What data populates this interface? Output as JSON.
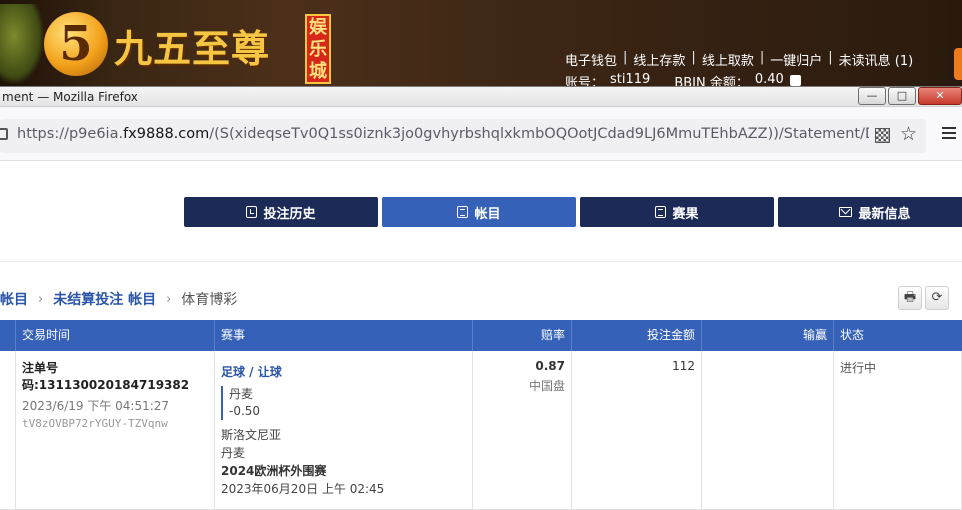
{
  "site": {
    "logo_mark": "5",
    "logo_title": "九五至尊",
    "logo_badge": [
      "娱",
      "乐",
      "城"
    ],
    "top_links": [
      "电子钱包",
      "线上存款",
      "线上取款",
      "一键归户",
      "未读讯息 (1)"
    ],
    "account_label": "账号：",
    "account_value": "sti119",
    "balance_label": "BBIN 余额：",
    "balance_value": "0.40"
  },
  "window": {
    "title": "ment — Mozilla Firefox",
    "buttons": [
      "—",
      "□",
      "✕"
    ]
  },
  "browser": {
    "url_prefix": "https://p9e6ia.",
    "url_host": "fx9888.com",
    "url_rest": "/(S(xideqseTv0Q1ss0iznk3jo0gvhyrbshqlxkmbOQOotJCdad9LJ6MmuTEhbAZZ))/Statement/DBetList?da"
  },
  "nav": {
    "tabs": [
      {
        "label": "投注历史",
        "icon": "clock"
      },
      {
        "label": "帐目",
        "icon": "list"
      },
      {
        "label": "赛果",
        "icon": "list"
      },
      {
        "label": "最新信息",
        "icon": "mail"
      }
    ]
  },
  "breadcrumb": {
    "items": [
      "帐目",
      "未结算投注 帐目"
    ],
    "current": "体育博彩"
  },
  "tools": {
    "print": "🖶",
    "refresh": "⟳"
  },
  "table": {
    "headers": [
      "",
      "交易时间",
      "赛事",
      "赔率",
      "投注金额",
      "输赢",
      "状态"
    ],
    "rows": [
      {
        "bet_no": "注单号码:131130020184719382",
        "time": "2023/6/19 下午 04:51:27",
        "code": "tV8zOVBP72rYGUY-TZVqnw",
        "sport": "足球 / 让球",
        "selection": "丹麦",
        "handicap": "-0.50",
        "home": "斯洛文尼亚",
        "away": "丹麦",
        "league": "2024欧洲杯外围赛",
        "match_time": "2023年06月20日 上午 02:45",
        "odds": "0.87",
        "odds_type": "中国盘",
        "stake": "112",
        "win_loss": "",
        "status": "进行中"
      }
    ]
  }
}
